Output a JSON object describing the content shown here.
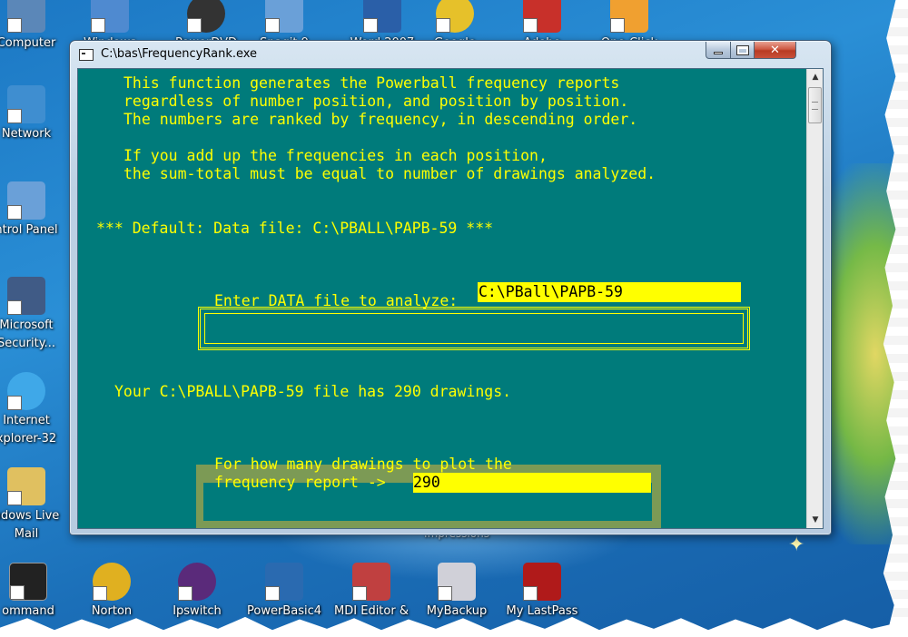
{
  "desktop": {
    "left_icons": [
      {
        "label": "Computer",
        "color": "#5b87b8"
      },
      {
        "label": "Network",
        "color": "#3f8ed0"
      },
      {
        "label": "ntrol Panel",
        "color": "#6aa0d8"
      },
      {
        "label": "Microsoft Security...",
        "color": "#405b86"
      },
      {
        "label": "Internet xplorer-32",
        "color": "#3fa8e8"
      },
      {
        "label": "ndows Live Mail",
        "color": "#e0c060"
      }
    ],
    "top_icons": [
      {
        "label": "Windows",
        "color": "#4f8ad0"
      },
      {
        "label": "PowerDVD",
        "color": "#333333"
      },
      {
        "label": "Snagit 9",
        "color": "#6aa0d8"
      },
      {
        "label": "Word 2007",
        "color": "#2a5fa8"
      },
      {
        "label": "Google",
        "color": "#e6c12a"
      },
      {
        "label": "Adobe",
        "color": "#c8302a"
      },
      {
        "label": "One-Click",
        "color": "#f0a030"
      }
    ],
    "bottom_icons": [
      {
        "label": "ommand",
        "color": "#222222"
      },
      {
        "label": "Norton",
        "color": "#e0b020"
      },
      {
        "label": "Ipswitch",
        "color": "#5a2a7a"
      },
      {
        "label": "PowerBasic4",
        "color": "#2a6ab0"
      },
      {
        "label": "MDI Editor &",
        "color": "#c04040"
      },
      {
        "label": "MyBackup",
        "color": "#d0d0d8"
      },
      {
        "label": "My LastPass",
        "color": "#b01a1a"
      }
    ],
    "partial_label": "Impressions"
  },
  "window": {
    "title": "C:\\bas\\FrequencyRank.exe",
    "min_label": "",
    "max_label": "",
    "close_label": "✕"
  },
  "console": {
    "intro": [
      "This function generates the Powerball frequency reports",
      "regardless of number position, and position by position.",
      "The numbers are ranked by frequency, in descending order.",
      "",
      "If you add up the frequencies in each position,",
      "the sum-total must be equal to number of drawings analyzed."
    ],
    "default_line": "*** Default: Data file: C:\\PBALL\\PAPB-59 ***",
    "data_prompt": "Enter DATA file to analyze:",
    "data_value": "C:\\PBall\\PAPB-59",
    "result_line": "Your C:\\PBALL\\PAPB-59 file has 290 drawings.",
    "plot_prompt_1": "For how many drawings to plot the",
    "plot_prompt_2": "frequency report ->",
    "plot_value": "290"
  },
  "scrollbar": {
    "up_arrow": "▲",
    "down_arrow": "▼"
  },
  "colors": {
    "console_bg": "#007b7b",
    "console_fg": "#ffff00",
    "input_bg": "#ffff00"
  }
}
